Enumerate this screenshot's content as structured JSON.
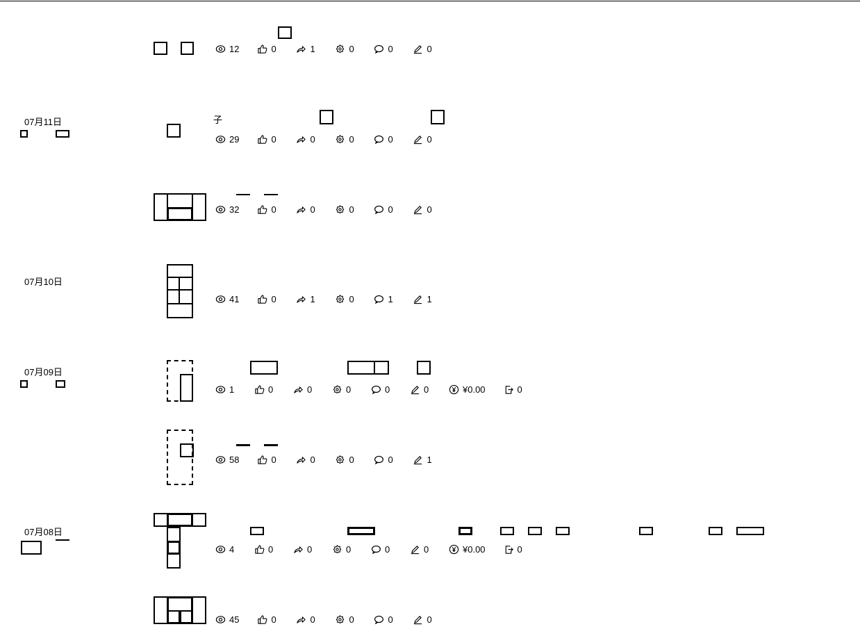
{
  "dates": [
    "07月11日",
    "07月10日",
    "07月09日",
    "07月08日"
  ],
  "posts": [
    {
      "title": "",
      "stats": {
        "views": "12",
        "likes": "0",
        "shares": "1",
        "favorites": "0",
        "comments": "0",
        "edits": "0"
      }
    },
    {
      "title": "子",
      "stats": {
        "views": "29",
        "likes": "0",
        "shares": "0",
        "favorites": "0",
        "comments": "0",
        "edits": "0"
      }
    },
    {
      "title": "",
      "stats": {
        "views": "32",
        "likes": "0",
        "shares": "0",
        "favorites": "0",
        "comments": "0",
        "edits": "0"
      }
    },
    {
      "title": "",
      "stats": {
        "views": "41",
        "likes": "0",
        "shares": "1",
        "favorites": "0",
        "comments": "1",
        "edits": "1"
      }
    },
    {
      "title": "",
      "stats": {
        "views": "1",
        "likes": "0",
        "shares": "0",
        "favorites": "0",
        "comments": "0",
        "edits": "0",
        "earnings": "¥0.00",
        "exports": "0"
      }
    },
    {
      "title": "",
      "stats": {
        "views": "58",
        "likes": "0",
        "shares": "0",
        "favorites": "0",
        "comments": "0",
        "edits": "1"
      }
    },
    {
      "title": "",
      "stats": {
        "views": "4",
        "likes": "0",
        "shares": "0",
        "favorites": "0",
        "comments": "0",
        "edits": "0",
        "earnings": "¥0.00",
        "exports": "0"
      }
    },
    {
      "title": "",
      "stats": {
        "views": "45",
        "likes": "0",
        "shares": "0",
        "favorites": "0",
        "comments": "0",
        "edits": "0"
      }
    }
  ],
  "icons": {
    "views": "eye-icon",
    "likes": "thumbs-up-icon",
    "shares": "share-icon",
    "favorites": "favorite-icon",
    "comments": "comment-icon",
    "edits": "pen-icon",
    "earnings": "yen-icon",
    "exports": "export-icon"
  }
}
